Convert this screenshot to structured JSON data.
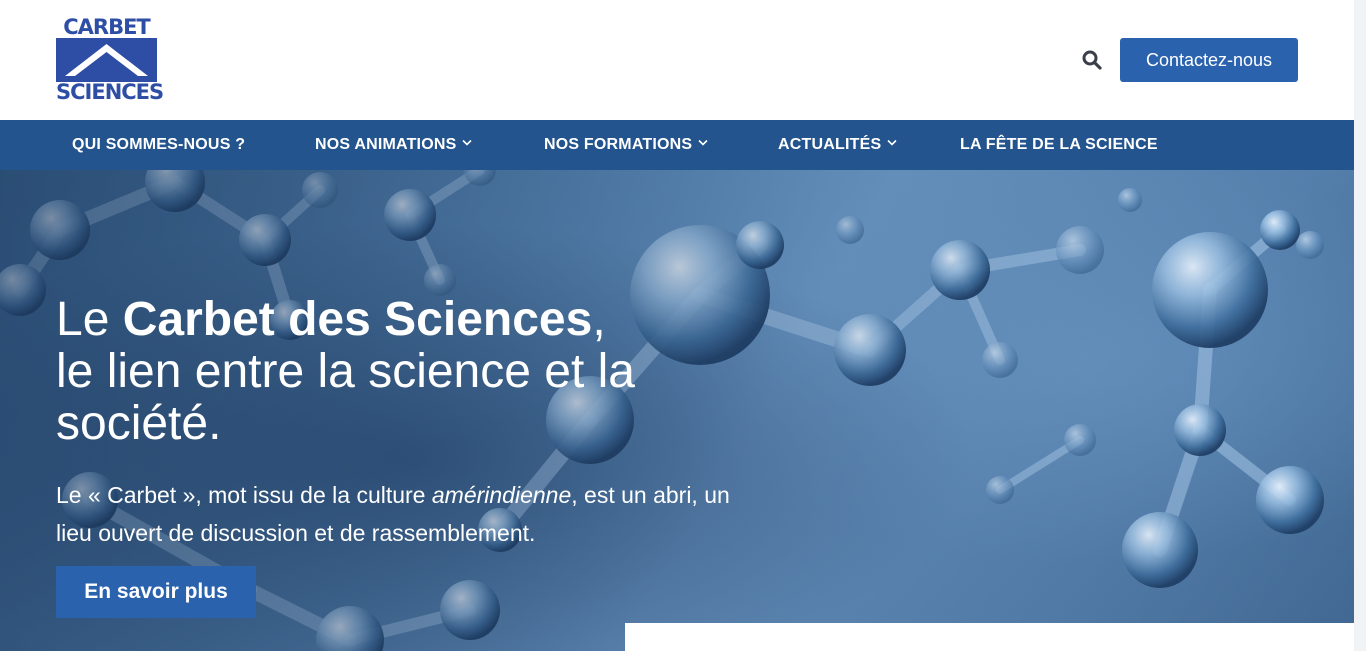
{
  "header": {
    "logo": {
      "top_text": "CARBET",
      "bottom_text": "SCIENCES",
      "color": "#2e4ea6"
    },
    "search_icon": "search-icon",
    "contact_label": "Contactez-nous"
  },
  "nav": {
    "background": "#23548e",
    "items": [
      {
        "label": "QUI SOMMES-NOUS ?",
        "has_dropdown": false
      },
      {
        "label": "NOS ANIMATIONS",
        "has_dropdown": true
      },
      {
        "label": "NOS FORMATIONS",
        "has_dropdown": true
      },
      {
        "label": "ACTUALITÉS",
        "has_dropdown": true
      },
      {
        "label": "LA FÊTE DE LA SCIENCE",
        "has_dropdown": false
      }
    ]
  },
  "hero": {
    "title_prefix": "Le ",
    "title_bold": "Carbet des Sciences",
    "title_comma": ",",
    "title_line2": "le lien entre la science et la",
    "title_line3": "société.",
    "text_part1": "Le « Carbet », mot issu de la culture ",
    "text_italic": "amérindienne",
    "text_part2": ", est un abri, un lieu ouvert de discussion et de rassemblement.",
    "button_label": "En savoir plus"
  },
  "colors": {
    "accent": "#2a62ae",
    "nav": "#23548e",
    "text_on_dark": "#ffffff"
  }
}
